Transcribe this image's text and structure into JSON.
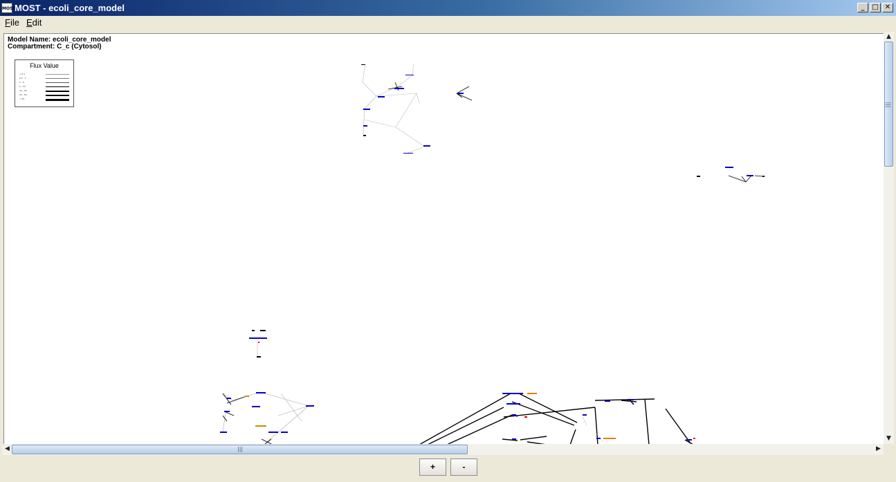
{
  "window": {
    "app_icon_text": "MOST",
    "title": "MOST - ecoli_core_model",
    "controls": {
      "minimize": "_",
      "maximize": "□",
      "close": "✕"
    }
  },
  "menu": {
    "file": "File",
    "edit": "Edit"
  },
  "canvas": {
    "model_name": "Model Name: ecoli_core_model",
    "compartment": "Compartment: C_c (Cytosol)"
  },
  "legend": {
    "title": "Flux Value",
    "rows": [
      "< 0.1",
      "0.1 - 1",
      "1 - 5",
      "5 - 10",
      "10 - 20",
      "20 - 50",
      "> 50"
    ]
  },
  "scrollbars": {
    "up_arrow": "▲",
    "down_arrow": "▼",
    "left_arrow": "◀",
    "right_arrow": "▶",
    "grip": "|||"
  },
  "zoom": {
    "in_label": "+",
    "out_label": "-"
  },
  "colors": {
    "node_blue": "#0000cc",
    "node_orange": "#e08000",
    "edge": "#000000"
  }
}
